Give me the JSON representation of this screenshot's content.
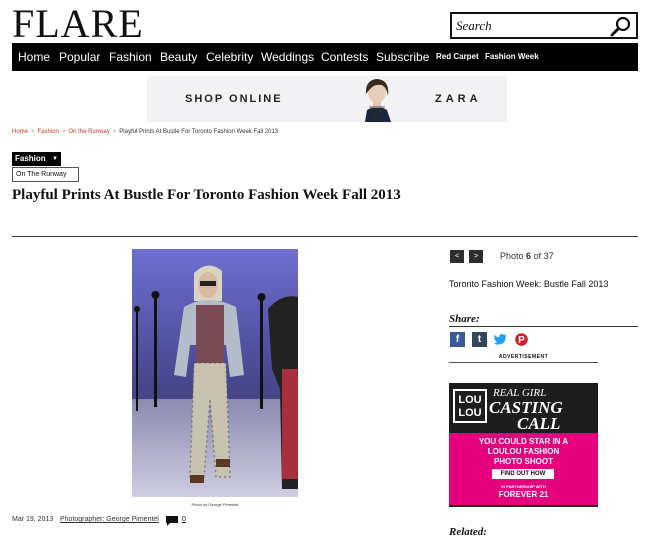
{
  "header": {
    "logo": "FLARE",
    "search_placeholder": "Search"
  },
  "nav": {
    "items": [
      "Home",
      "Popular",
      "Fashion",
      "Beauty",
      "Celebrity",
      "Weddings",
      "Contests",
      "Subscribe",
      "Red Carpet",
      "Fashion Week"
    ]
  },
  "banner_ad": {
    "text": "SHOP ONLINE",
    "brand": "ZARA"
  },
  "breadcrumb": {
    "items": [
      "Home",
      "Fashion",
      "On the Runway"
    ],
    "current": "Playful Prints At Bustle For Toronto Fashion Week Fall 2013"
  },
  "article": {
    "category": "Fashion",
    "subcategory": "On The Runway",
    "title": "Playful Prints At Bustle For Toronto Fashion Week Fall 2013",
    "photo_credit": "Photo by George Pimentel",
    "date": "Mar 19, 2013",
    "photographer": "Photographer: George Pimentel",
    "comment_count": "0"
  },
  "gallery": {
    "prev_label": "<",
    "next_label": ">",
    "photo_prefix": "Photo",
    "current": "6",
    "of_label": "of",
    "total": "37",
    "title": "Toronto Fashion Week: Bustle Fall 2013"
  },
  "share": {
    "label": "Share:",
    "networks": [
      "facebook-icon",
      "tumblr-icon",
      "twitter-icon",
      "pinterest-icon"
    ]
  },
  "sidebar_ad": {
    "label": "ADVERTISEMENT",
    "logo_line1": "LOU",
    "logo_line2": "LOU",
    "line1": "REAL GIRL",
    "line2": "CASTING",
    "line3": "CALL",
    "star_line1": "YOU COULD STAR IN A",
    "star_line2": "LOULOU FASHION",
    "star_line3": "PHOTO SHOOT",
    "cta": "FIND OUT HOW",
    "partner_label": "IN PARTNERSHIP WITH",
    "partner": "FOREVER 21"
  },
  "related": {
    "label": "Related:"
  },
  "colors": {
    "nav_bg": "#000000",
    "accent_pink": "#e5007e",
    "breadcrumb_link": "#c0392b"
  }
}
